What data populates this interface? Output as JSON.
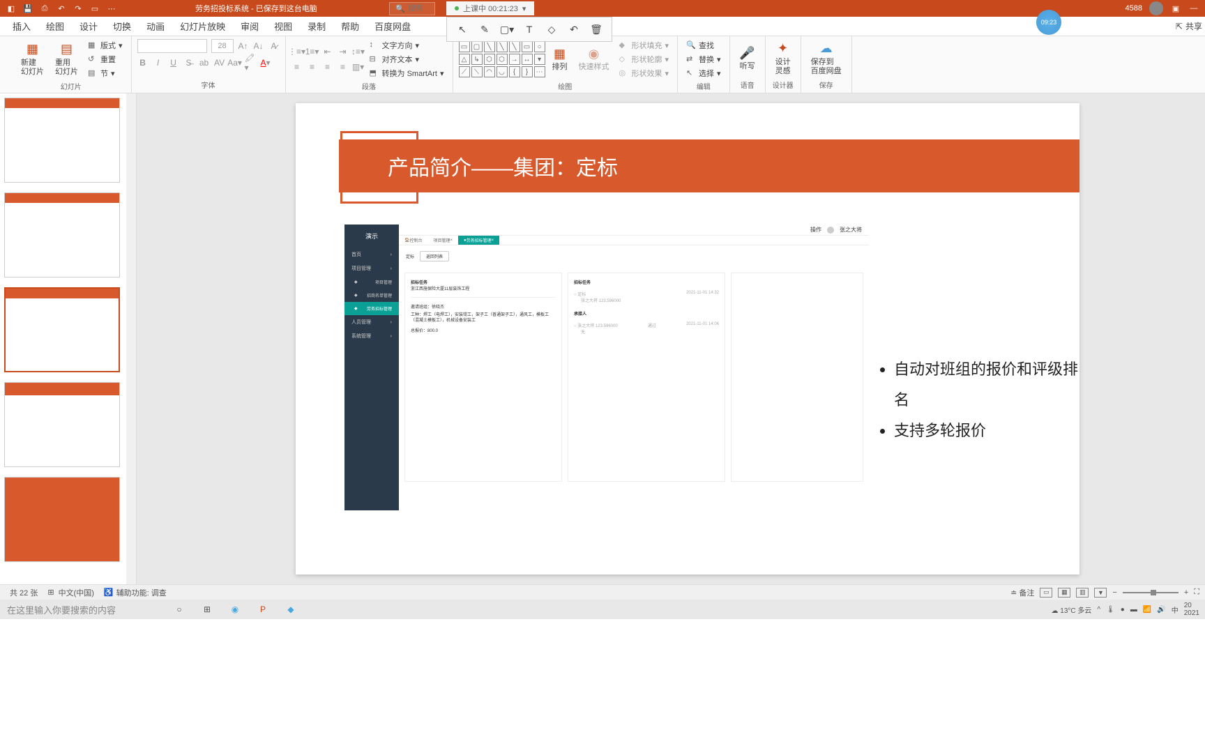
{
  "titlebar": {
    "doc_title": "劳务招投标系统 - 已保存到这台电脑",
    "search_placeholder": "搜索",
    "timer": "上课中 00:21:23",
    "user_number": "4588"
  },
  "clock_overlay": "09:23",
  "ribbon_tabs": {
    "items": [
      "插入",
      "绘图",
      "设计",
      "切换",
      "动画",
      "幻灯片放映",
      "审阅",
      "视图",
      "录制",
      "帮助",
      "百度网盘"
    ],
    "share": "共享"
  },
  "ribbon": {
    "slides_group": "幻灯片",
    "new_slide": "新建\n幻灯片",
    "reuse_slide": "重用\n幻灯片",
    "layout": "版式",
    "reset": "重置",
    "section": "节",
    "font_group": "字体",
    "font_size": "28",
    "paragraph_group": "段落",
    "text_direction": "文字方向",
    "align_text": "对齐文本",
    "convert_smartart": "转换为 SmartArt",
    "drawing_group": "绘图",
    "arrange": "排列",
    "quick_style": "快速样式",
    "shape_fill": "形状填充",
    "shape_outline": "形状轮廓",
    "shape_effects": "形状效果",
    "editing_group": "编辑",
    "find": "查找",
    "replace": "替换",
    "select": "选择",
    "voice_group": "语音",
    "dictate": "听写",
    "designer_group": "设计器",
    "designer": "设计\n灵感",
    "save_group": "保存",
    "save_baidu": "保存到\n百度网盘"
  },
  "slide": {
    "title": "产品简介——集团：定标",
    "bullets": [
      "自动对班组的报价和评级排名",
      "支持多轮报价"
    ],
    "app": {
      "sidebar_title": "演示",
      "menu": {
        "home": "首页",
        "project": "项目管理",
        "project_sub": "项目管理",
        "list_mgmt": "招商名单管理",
        "bid_mgmt": "劳务招标管理",
        "person": "人员管理",
        "system": "系统管理"
      },
      "tabs": {
        "console": "控制台",
        "project": "项目管理",
        "bid": "劳务招标管理"
      },
      "topbar_user": "张之大将",
      "topbar_action": "操作",
      "content": {
        "dingbiao": "定标",
        "back": "返回列表",
        "task_label": "招标任务",
        "task_name": "浙江西施保险大厦11层装饰工程",
        "contact_label": "邀请班组：徐晓杰",
        "work_detail": "工种：焊工（电焊工），安装钳工，架子工（普通架子工），通风工，模板工（混凝土模板工），机械设备安装工",
        "price": "总报价：800.0",
        "right_task": "招标任务",
        "timeline_1": "定标",
        "timeline_1_date": "2021-11-01 14:32",
        "timeline_1_detail": "张之大将 123.596000",
        "awardee": "承接人",
        "timeline_2_name": "张之大将 123.596000",
        "timeline_2_status": "通过",
        "timeline_2_date": "2021-11-01 14:06",
        "reason": "无"
      }
    }
  },
  "statusbar": {
    "slide_count": "共 22 张",
    "language": "中文(中国)",
    "accessibility": "辅助功能: 调查",
    "notes": "备注"
  },
  "taskbar": {
    "search_placeholder": "在这里输入你要搜索的内容",
    "weather": "13°C 多云",
    "ime": "中",
    "year": "2021"
  }
}
